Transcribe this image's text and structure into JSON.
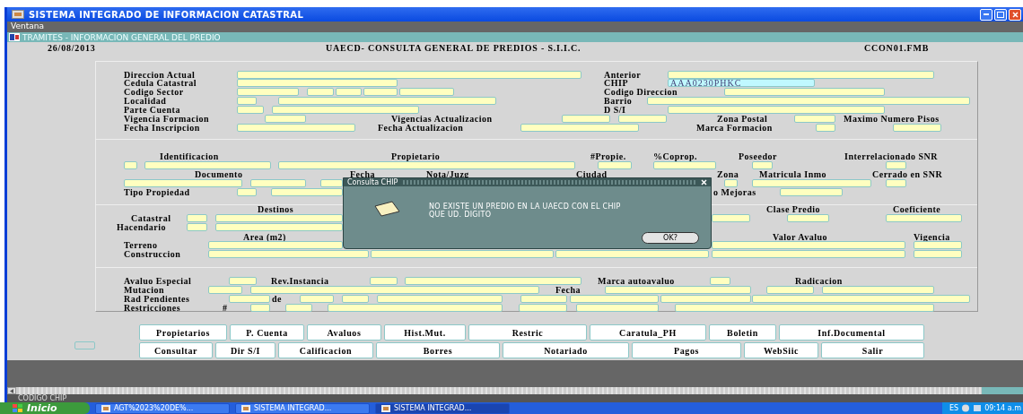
{
  "window": {
    "title": "SISTEMA INTEGRADO DE INFORMACION CATASTRAL"
  },
  "menu": [
    "Ventana"
  ],
  "inner_window": {
    "title": "TRAMITES - INFORMACION GENERAL DEL PREDIO"
  },
  "header": {
    "date": "26/08/2013",
    "title": "UAECD- CONSULTA GENERAL DE PREDIOS - S.I.I.C.",
    "form": "CCON01.FMB"
  },
  "sections": [
    {
      "labels": [
        "Direccion Actual",
        "Anterior",
        "Cedula Catastral",
        "CHIP",
        "Codigo Sector",
        "Codigo Direccion",
        "Localidad",
        "Barrio",
        "Parte Cuenta",
        "D S/I",
        "Vigencia Formacion",
        "Vigencias Actualizacion",
        "Zona Postal",
        "Maximo Numero Pisos",
        "Fecha Inscripcion",
        "Fecha Actualizacion",
        "Marca Formacion"
      ]
    },
    {
      "labels": [
        "Identificacion",
        "Propietario",
        "#Propie.",
        "%Coprop.",
        "Poseedor",
        "Interrelacionado SNR",
        "Documento",
        "Fecha",
        "Nota/Juzg",
        "Ciudad",
        "Zona",
        "Matricula Inmo",
        "Cerrado en SNR",
        "Tipo Propiedad",
        "o Mejoras"
      ]
    },
    {
      "labels": [
        "Destinos",
        "Clase Predio",
        "Coeficiente",
        "Catastral",
        "Hacendario",
        "Area  (m2)",
        "Valor Avaluo",
        "Vigencia",
        "Terreno",
        "Construccion"
      ]
    },
    {
      "labels": [
        "Avaluo Especial",
        "Rev.Instancia",
        "Marca autoavaluo",
        "Radicacion",
        "Mutacion",
        "Fecha",
        "Rad Pendientes",
        "de",
        "Restricciones",
        "#"
      ]
    }
  ],
  "chip_field": {
    "value": "AAA0230PHKC",
    "focused": true
  },
  "buttons": [
    [
      "Propietarios",
      "P. Cuenta",
      "Avaluos",
      "Hist.Mut.",
      "Restric",
      "Caratula_PH",
      "Boletin",
      "Inf.Documental"
    ],
    [
      "Consultar",
      "Dir S/I",
      "Calificacion",
      "Borres",
      "Notariado",
      "Pagos",
      "WebSiic",
      "Salir"
    ]
  ],
  "dialog": {
    "title": "Consulta CHIP",
    "message": "NO EXISTE UN PREDIO EN LA UAECD CON EL CHIP\nQUE UD. DIGITO",
    "button": "OK?"
  },
  "status_bar": {
    "text": "CODIGO CHIP"
  },
  "taskbar": {
    "start": "Inicio",
    "tasks": [
      {
        "label": "AGT%2023%20DE%...",
        "selected": false
      },
      {
        "label": "SISTEMA INTEGRAD...",
        "selected": false
      },
      {
        "label": "SISTEMA INTEGRAD...",
        "selected": true
      }
    ],
    "language": "ES",
    "time": "09:14 a.m"
  }
}
